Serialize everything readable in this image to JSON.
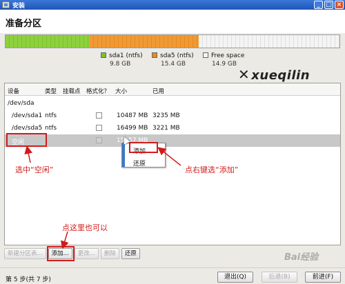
{
  "window": {
    "title": "安装",
    "controls": [
      "_",
      "□",
      "×"
    ]
  },
  "header": {
    "title": "准备分区"
  },
  "disk": {
    "colors": {
      "sda1": "#7cc12c",
      "sda5": "#e58a22",
      "free": "#f4f4f4"
    },
    "legend": [
      {
        "name": "sda1 (ntfs)",
        "size": "9.8 GB"
      },
      {
        "name": "sda5 (ntfs)",
        "size": "15.4 GB"
      },
      {
        "name": "Free space",
        "size": "14.9 GB"
      }
    ]
  },
  "watermark": {
    "text": "xueqilin"
  },
  "table": {
    "headers": [
      "设备",
      "类型",
      "挂载点",
      "格式化？",
      "大小",
      "已用"
    ],
    "rows": [
      {
        "device": "/dev/sda",
        "type": "",
        "size": "",
        "used": ""
      },
      {
        "device": "/dev/sda1",
        "type": "ntfs",
        "size": "10487 MB",
        "used": "3235 MB"
      },
      {
        "device": "/dev/sda5",
        "type": "ntfs",
        "size": "16499 MB",
        "used": "3221 MB"
      },
      {
        "device": "空闲",
        "type": "",
        "size": "15957 MB",
        "used": ""
      }
    ]
  },
  "context_menu": {
    "items": [
      "添加...",
      "还原"
    ]
  },
  "annotations": {
    "select_free": "选中“空闲”",
    "right_click_add": "点右键选“添加”",
    "click_here": "点这里也可以"
  },
  "buttons": {
    "new_table": "新建分区表...",
    "add": "添加...",
    "change": "更改...",
    "delete": "删除",
    "revert": "还原"
  },
  "footer": {
    "step": "第 5 步(共 7 步)",
    "quit": "退出(Q)",
    "back": "后退(B)",
    "forward": "前进(F)"
  },
  "baidu_watermark": "Bai经验"
}
